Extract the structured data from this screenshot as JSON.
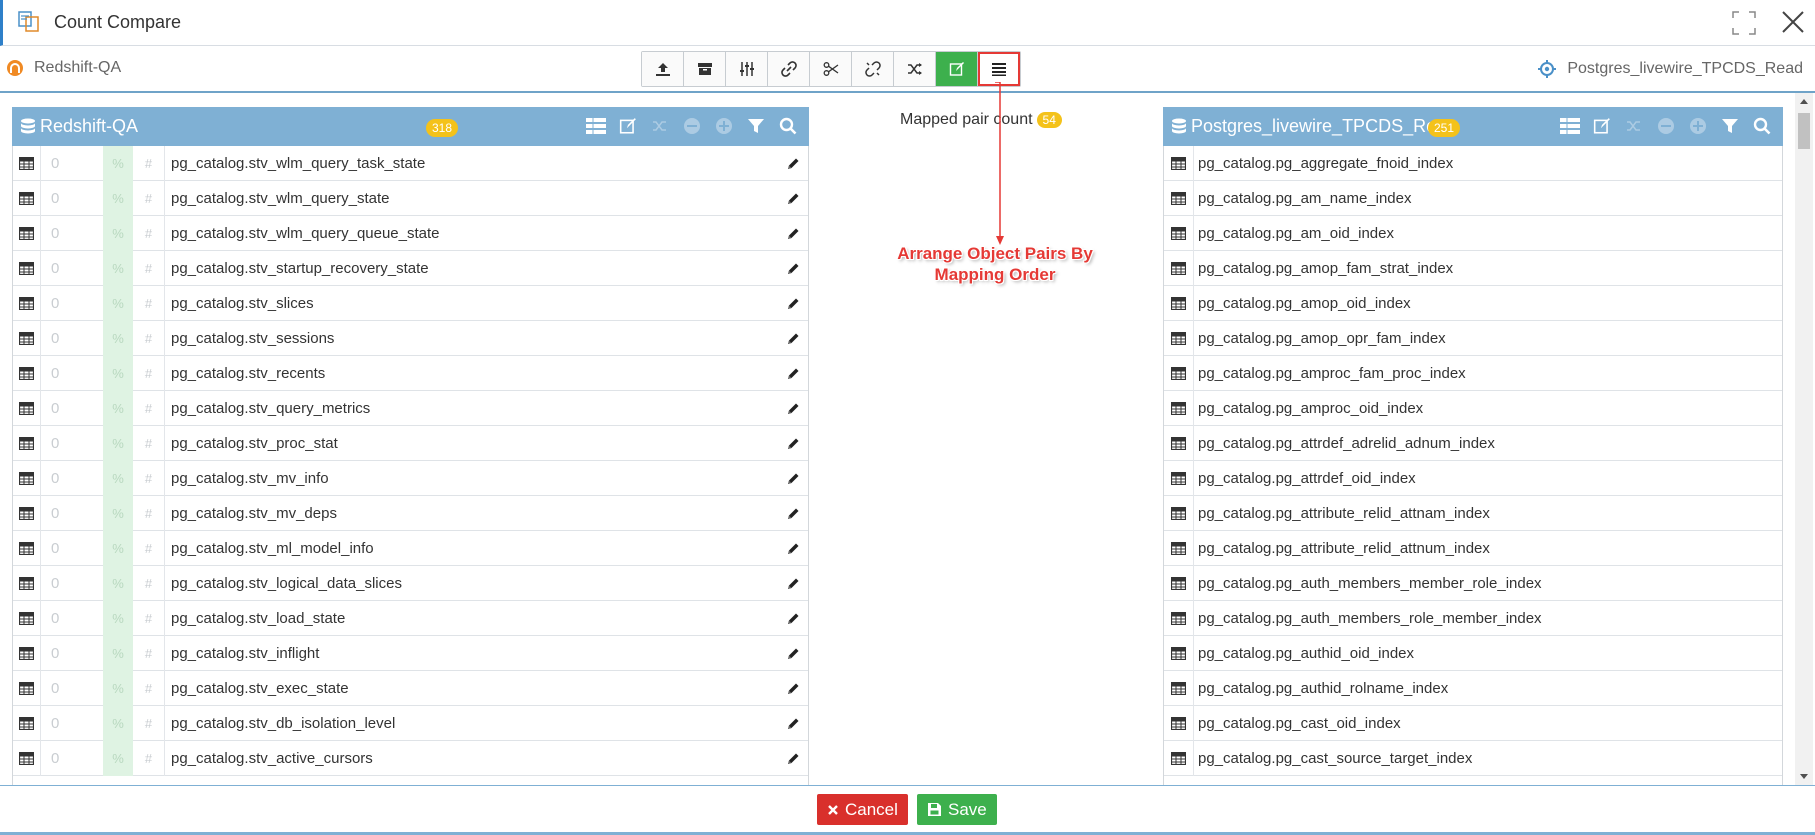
{
  "window": {
    "title": "Count Compare"
  },
  "connections": {
    "source": "Redshift-QA",
    "target": "Postgres_livewire_TPCDS_Read"
  },
  "toolbar": {
    "buttons": [
      {
        "icon": "upload-icon"
      },
      {
        "icon": "archive-icon"
      },
      {
        "icon": "sliders-icon"
      },
      {
        "icon": "link-icon"
      },
      {
        "icon": "scissors-icon"
      },
      {
        "icon": "unlink-icon"
      },
      {
        "icon": "shuffle-icon"
      },
      {
        "icon": "edit-icon",
        "active": true
      },
      {
        "icon": "list-icon",
        "highlighted": true
      }
    ]
  },
  "left_panel": {
    "title": "Redshift-QA",
    "count": "318",
    "rows": [
      {
        "count": "0",
        "pct": "%",
        "hash": "#",
        "name": "pg_catalog.stv_wlm_query_task_state"
      },
      {
        "count": "0",
        "pct": "%",
        "hash": "#",
        "name": "pg_catalog.stv_wlm_query_state"
      },
      {
        "count": "0",
        "pct": "%",
        "hash": "#",
        "name": "pg_catalog.stv_wlm_query_queue_state"
      },
      {
        "count": "0",
        "pct": "%",
        "hash": "#",
        "name": "pg_catalog.stv_startup_recovery_state"
      },
      {
        "count": "0",
        "pct": "%",
        "hash": "#",
        "name": "pg_catalog.stv_slices"
      },
      {
        "count": "0",
        "pct": "%",
        "hash": "#",
        "name": "pg_catalog.stv_sessions"
      },
      {
        "count": "0",
        "pct": "%",
        "hash": "#",
        "name": "pg_catalog.stv_recents"
      },
      {
        "count": "0",
        "pct": "%",
        "hash": "#",
        "name": "pg_catalog.stv_query_metrics"
      },
      {
        "count": "0",
        "pct": "%",
        "hash": "#",
        "name": "pg_catalog.stv_proc_stat"
      },
      {
        "count": "0",
        "pct": "%",
        "hash": "#",
        "name": "pg_catalog.stv_mv_info"
      },
      {
        "count": "0",
        "pct": "%",
        "hash": "#",
        "name": "pg_catalog.stv_mv_deps"
      },
      {
        "count": "0",
        "pct": "%",
        "hash": "#",
        "name": "pg_catalog.stv_ml_model_info"
      },
      {
        "count": "0",
        "pct": "%",
        "hash": "#",
        "name": "pg_catalog.stv_logical_data_slices"
      },
      {
        "count": "0",
        "pct": "%",
        "hash": "#",
        "name": "pg_catalog.stv_load_state"
      },
      {
        "count": "0",
        "pct": "%",
        "hash": "#",
        "name": "pg_catalog.stv_inflight"
      },
      {
        "count": "0",
        "pct": "%",
        "hash": "#",
        "name": "pg_catalog.stv_exec_state"
      },
      {
        "count": "0",
        "pct": "%",
        "hash": "#",
        "name": "pg_catalog.stv_db_isolation_level"
      },
      {
        "count": "0",
        "pct": "%",
        "hash": "#",
        "name": "pg_catalog.stv_active_cursors"
      }
    ]
  },
  "right_panel": {
    "title": "Postgres_livewire_TPCDS_Re",
    "count": "251",
    "rows": [
      {
        "name": "pg_catalog.pg_aggregate_fnoid_index"
      },
      {
        "name": "pg_catalog.pg_am_name_index"
      },
      {
        "name": "pg_catalog.pg_am_oid_index"
      },
      {
        "name": "pg_catalog.pg_amop_fam_strat_index"
      },
      {
        "name": "pg_catalog.pg_amop_oid_index"
      },
      {
        "name": "pg_catalog.pg_amop_opr_fam_index"
      },
      {
        "name": "pg_catalog.pg_amproc_fam_proc_index"
      },
      {
        "name": "pg_catalog.pg_amproc_oid_index"
      },
      {
        "name": "pg_catalog.pg_attrdef_adrelid_adnum_index"
      },
      {
        "name": "pg_catalog.pg_attrdef_oid_index"
      },
      {
        "name": "pg_catalog.pg_attribute_relid_attnam_index"
      },
      {
        "name": "pg_catalog.pg_attribute_relid_attnum_index"
      },
      {
        "name": "pg_catalog.pg_auth_members_member_role_index"
      },
      {
        "name": "pg_catalog.pg_auth_members_role_member_index"
      },
      {
        "name": "pg_catalog.pg_authid_oid_index"
      },
      {
        "name": "pg_catalog.pg_authid_rolname_index"
      },
      {
        "name": "pg_catalog.pg_cast_oid_index"
      },
      {
        "name": "pg_catalog.pg_cast_source_target_index"
      }
    ]
  },
  "center": {
    "mapped_label": "Mapped pair count",
    "mapped_count": "54"
  },
  "annotation": {
    "line1": "Arrange Object Pairs By",
    "line2": "Mapping Order"
  },
  "footer": {
    "cancel_label": "Cancel",
    "save_label": "Save"
  },
  "colors": {
    "accent": "#7fb0d4",
    "green": "#3db04d",
    "red": "#d9302c",
    "badge": "#f4c21a",
    "annotation": "#e53935"
  }
}
